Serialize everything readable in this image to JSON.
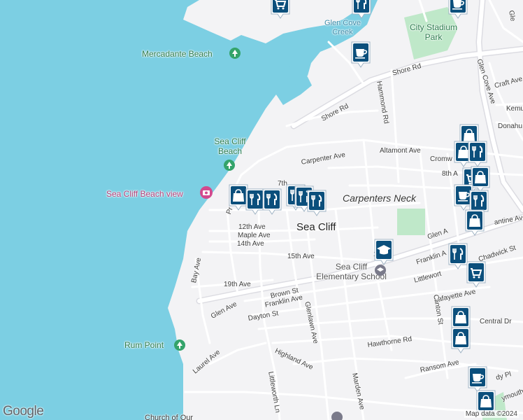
{
  "map": {
    "colors": {
      "water": "#7ccfe3",
      "land": "#f3f3f5",
      "road": "#ffffff",
      "roadEdge": "#d8d8df",
      "park": "#bfe8c9",
      "pin": "#0b4f7c"
    },
    "neighborhood": "Sea Cliff",
    "district": "Carpenters Neck",
    "places": {
      "mercadante": "Mercadante Beach",
      "seacliff_beach_1": "Sea Cliff",
      "seacliff_beach_2": "Beach",
      "beach_view": "Sea Cliff Beach view",
      "rum_point": "Rum Point",
      "city_stadium_1": "City Stadium",
      "city_stadium_2": "Park",
      "glen_cove_creek_1": "Glen Cove",
      "glen_cove_creek_2": "Creek",
      "school_1": "Sea Cliff",
      "school_2": "Elementary School",
      "church": "Church of Our"
    },
    "streets": {
      "shore_rd": "Shore Rd",
      "shore_rd2": "Shore Rd",
      "hammond": "Hammond Rd",
      "glen_cove_ave": "Glen Cove Ave",
      "craft": "Craft Ave",
      "kemu": "Kemu",
      "donahue": "Donahu",
      "carpenter": "Carpenter Ave",
      "altamont": "Altamont Ave",
      "cromwell": "Cromw",
      "eighth": "8th A",
      "seventh": "7th",
      "twelfth": "12th Ave",
      "maple": "Maple Ave",
      "fourteenth": "14th Ave",
      "fifteenth": "15th Ave",
      "nineteenth": "19th Ave",
      "bay": "Bay Ave",
      "glen_ave": "Glen Ave",
      "glen_a": "Glen A",
      "brown": "Brown St",
      "franklin": "Franklin Ave",
      "franklin2": "Franklin A",
      "dayton": "Dayton St",
      "glenlawn": "Glenlawn Ave",
      "littleworth": "Littlewort",
      "littleworth_ln": "Littleworth Ln",
      "chadwick": "Chadwick St",
      "lafayette": "Lafayette Ave",
      "clinton": "Clinton St",
      "central": "Central Dr",
      "hawthorne": "Hawthorne Rd",
      "highland": "Highland Ave",
      "laurel": "Laurel Ave",
      "marden": "Marden Ave",
      "ransom": "Ransom Ave",
      "prospect": "Pr",
      "antine": "antine Ave",
      "dy_pl": "dy Pl",
      "ymouth": "ymouth",
      "glen_top": "Gle",
      "one": "1"
    },
    "branding": {
      "logo": "Google",
      "attribution": "Map data ©2024"
    },
    "pois": [
      {
        "id": "grocery-1",
        "icon": "cart"
      },
      {
        "id": "restaurant-1",
        "icon": "fork-knife"
      },
      {
        "id": "cafe-1",
        "icon": "cup"
      },
      {
        "id": "cafe-2",
        "icon": "cup"
      },
      {
        "id": "shop-1",
        "icon": "bag"
      },
      {
        "id": "restaurant-2",
        "icon": "fork-knife"
      },
      {
        "id": "restaurant-3",
        "icon": "fork-knife"
      },
      {
        "id": "restaurant-4",
        "icon": "fork-knife"
      },
      {
        "id": "restaurant-5",
        "icon": "fork-knife"
      },
      {
        "id": "restaurant-6",
        "icon": "fork-knife"
      },
      {
        "id": "school-1",
        "icon": "graduation-cap"
      },
      {
        "id": "shop-2",
        "icon": "bag"
      },
      {
        "id": "shop-3",
        "icon": "bag"
      },
      {
        "id": "restaurant-7",
        "icon": "fork-knife"
      },
      {
        "id": "grocery-2",
        "icon": "cart"
      },
      {
        "id": "shop-4",
        "icon": "bag"
      },
      {
        "id": "cafe-3",
        "icon": "cup"
      },
      {
        "id": "restaurant-8",
        "icon": "fork-knife"
      },
      {
        "id": "shop-5",
        "icon": "bag"
      },
      {
        "id": "restaurant-9",
        "icon": "fork-knife"
      },
      {
        "id": "grocery-3",
        "icon": "cart"
      },
      {
        "id": "shop-6",
        "icon": "bag"
      },
      {
        "id": "shop-7",
        "icon": "bag"
      },
      {
        "id": "cafe-4",
        "icon": "cup"
      },
      {
        "id": "shop-8",
        "icon": "bag"
      }
    ]
  }
}
